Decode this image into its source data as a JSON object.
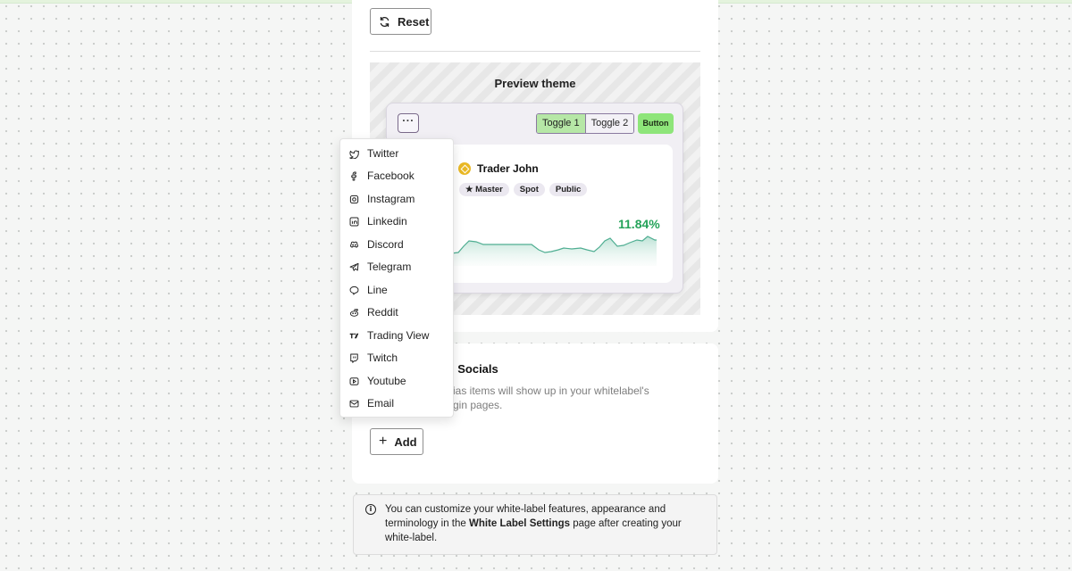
{
  "theme": {
    "reset_label": "Reset",
    "preview_title": "Preview theme",
    "preview": {
      "menu_glyph": "···",
      "toggles": [
        "Toggle 1",
        "Toggle 2"
      ],
      "button_label": "Button",
      "trader_name": "Trader John",
      "tags": [
        "Master",
        "Spot",
        "Public"
      ],
      "return_percent": "11.84%",
      "sparkline_color": "#4fae92"
    }
  },
  "socials_menu": {
    "items": [
      {
        "label": "Twitter",
        "icon": "twitter-icon"
      },
      {
        "label": "Facebook",
        "icon": "facebook-icon"
      },
      {
        "label": "Instagram",
        "icon": "instagram-icon"
      },
      {
        "label": "Linkedin",
        "icon": "linkedin-icon"
      },
      {
        "label": "Discord",
        "icon": "discord-icon"
      },
      {
        "label": "Telegram",
        "icon": "telegram-icon"
      },
      {
        "label": "Line",
        "icon": "line-icon"
      },
      {
        "label": "Reddit",
        "icon": "reddit-icon"
      },
      {
        "label": "Trading View",
        "icon": "tradingview-icon"
      },
      {
        "label": "Twitch",
        "icon": "twitch-icon"
      },
      {
        "label": "Youtube",
        "icon": "youtube-icon"
      },
      {
        "label": "Email",
        "icon": "email-icon"
      }
    ]
  },
  "socials": {
    "title_visible": "l Socials",
    "description_line1": "ias items will show up in your whitelabel's",
    "description_line2": "gin pages.",
    "add_label": "Add"
  },
  "info": {
    "text_before": "You can customize your white-label features, appearance and terminology in the ",
    "text_bold": "White Label Settings",
    "text_after": " page after creating your white-label."
  },
  "colors": {
    "accent_green": "#8ee57a",
    "positive_return": "#25a35a"
  }
}
